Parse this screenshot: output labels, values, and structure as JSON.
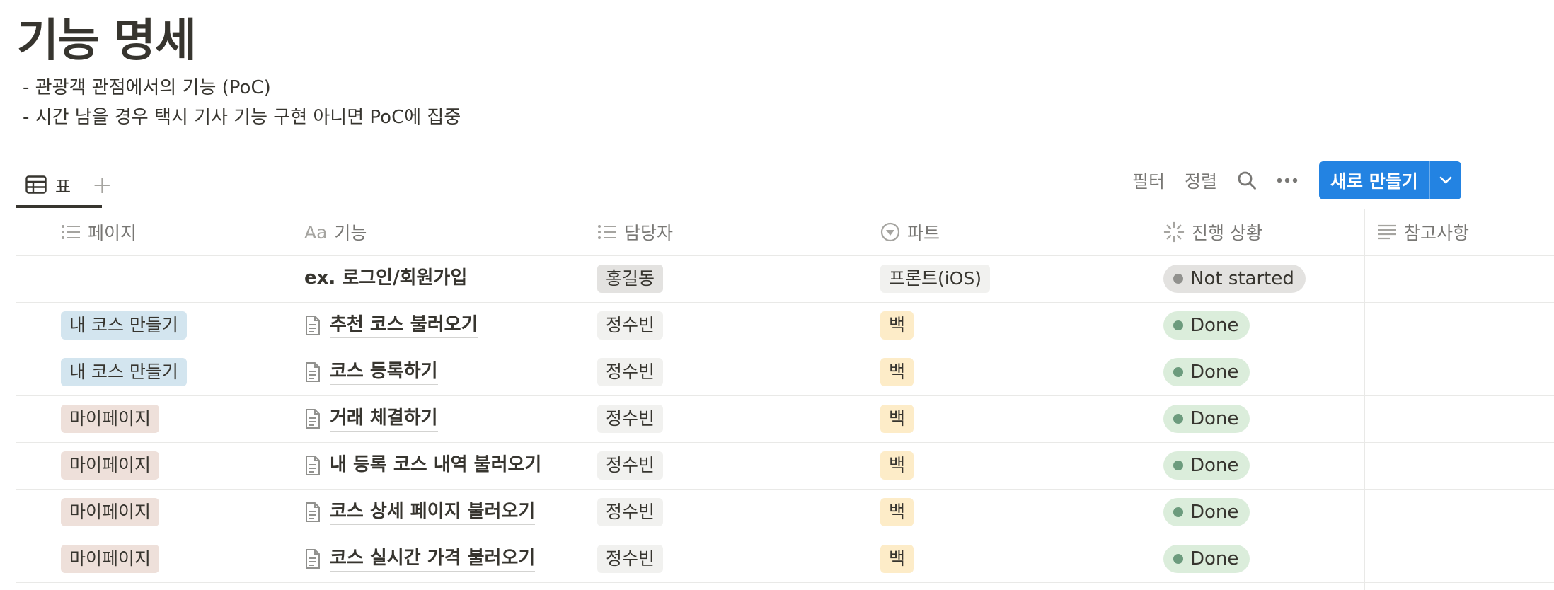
{
  "page": {
    "title": "기능 명세",
    "description": [
      "- 관광객 관점에서의 기능 (PoC)",
      "- 시간 남을 경우 택시 기사 기능 구현 아니면 PoC에 집중"
    ]
  },
  "view": {
    "tab_label": "표",
    "add_view_symbol": "+"
  },
  "toolbar": {
    "filter": "필터",
    "sort": "정렬",
    "new_button": "새로 만들기",
    "accent_color": "#2383e2"
  },
  "table": {
    "columns": [
      {
        "label": "페이지",
        "icon": "list-icon"
      },
      {
        "label": "기능",
        "icon": "text-aa-icon",
        "icon_text": "Aa"
      },
      {
        "label": "담당자",
        "icon": "list-icon"
      },
      {
        "label": "파트",
        "icon": "select-icon"
      },
      {
        "label": "진행 상황",
        "icon": "status-spinner-icon"
      },
      {
        "label": "참고사항",
        "icon": "text-lines-icon"
      }
    ],
    "rows": [
      {
        "page": "",
        "page_color": "",
        "feature": "ex. 로그인/회원가입",
        "has_doc_icon": false,
        "owner": "홍길동",
        "part": "프론트(iOS)",
        "status": "Not started"
      },
      {
        "page": "내 코스 만들기",
        "page_color": "blue",
        "feature": "추천 코스 불러오기",
        "has_doc_icon": true,
        "owner": "정수빈",
        "part": "백",
        "status": "Done"
      },
      {
        "page": "내 코스 만들기",
        "page_color": "blue",
        "feature": "코스 등록하기",
        "has_doc_icon": true,
        "owner": "정수빈",
        "part": "백",
        "status": "Done"
      },
      {
        "page": "마이페이지",
        "page_color": "brown",
        "feature": "거래 체결하기",
        "has_doc_icon": true,
        "owner": "정수빈",
        "part": "백",
        "status": "Done"
      },
      {
        "page": "마이페이지",
        "page_color": "brown",
        "feature": "내 등록 코스 내역 불러오기",
        "has_doc_icon": true,
        "owner": "정수빈",
        "part": "백",
        "status": "Done"
      },
      {
        "page": "마이페이지",
        "page_color": "brown",
        "feature": "코스 상세 페이지 불러오기",
        "has_doc_icon": true,
        "owner": "정수빈",
        "part": "백",
        "status": "Done"
      },
      {
        "page": "마이페이지",
        "page_color": "brown",
        "feature": "코스 실시간 가격 불러오기",
        "has_doc_icon": true,
        "owner": "정수빈",
        "part": "백",
        "status": "Done"
      }
    ]
  }
}
